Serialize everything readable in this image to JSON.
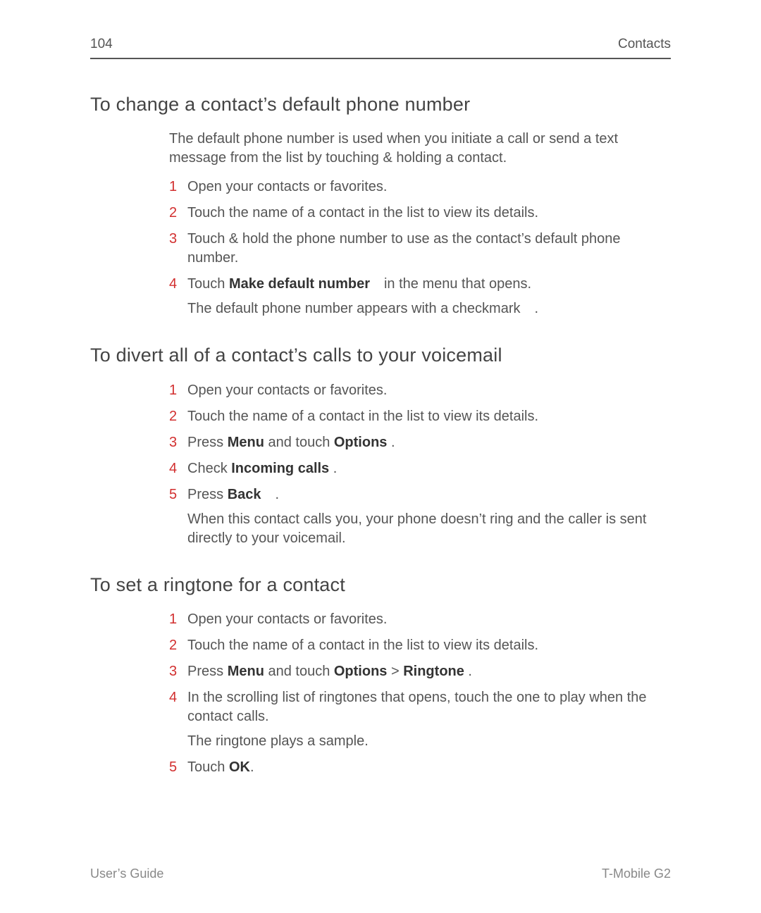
{
  "header": {
    "page_number": "104",
    "section": "Contacts"
  },
  "footer": {
    "left": "User’s Guide",
    "right": "T-Mobile G2"
  },
  "sections": [
    {
      "title": "To change a contact’s default phone number",
      "intro": "The default phone number is used when you initiate a call or send a text message from the list by touching & holding a contact.",
      "steps": [
        {
          "n": "1",
          "runs": [
            {
              "t": "Open your contacts or favorites."
            }
          ]
        },
        {
          "n": "2",
          "runs": [
            {
              "t": "Touch the name of a contact in the list to view its details."
            }
          ]
        },
        {
          "n": "3",
          "runs": [
            {
              "t": "Touch & hold the phone number to use as the contact’s default phone number."
            }
          ]
        },
        {
          "n": "4",
          "runs": [
            {
              "t": "Touch "
            },
            {
              "t": "Make default number",
              "b": true
            },
            {
              "t": " in the menu that opens."
            }
          ],
          "after": "The default phone number appears with a checkmark ."
        }
      ]
    },
    {
      "title": "To divert all of a contact’s calls to your voicemail",
      "steps": [
        {
          "n": "1",
          "runs": [
            {
              "t": "Open your contacts or favorites."
            }
          ]
        },
        {
          "n": "2",
          "runs": [
            {
              "t": "Touch the name of a contact in the list to view its details."
            }
          ]
        },
        {
          "n": "3",
          "runs": [
            {
              "t": "Press "
            },
            {
              "t": "Menu",
              "b": true
            },
            {
              "t": " and touch "
            },
            {
              "t": "Options",
              "b": true
            },
            {
              "t": " ."
            }
          ]
        },
        {
          "n": "4",
          "runs": [
            {
              "t": "Check "
            },
            {
              "t": "Incoming calls",
              "b": true
            },
            {
              "t": "  ."
            }
          ]
        },
        {
          "n": "5",
          "runs": [
            {
              "t": "Press "
            },
            {
              "t": "Back",
              "b": true
            },
            {
              "t": " ."
            }
          ],
          "after": "When this contact calls you, your phone doesn’t ring and the caller is sent directly to your voicemail."
        }
      ]
    },
    {
      "title": "To set a ringtone for a contact",
      "steps": [
        {
          "n": "1",
          "runs": [
            {
              "t": "Open your contacts or favorites."
            }
          ]
        },
        {
          "n": "2",
          "runs": [
            {
              "t": "Touch the name of a contact in the list to view its details."
            }
          ]
        },
        {
          "n": "3",
          "runs": [
            {
              "t": "Press "
            },
            {
              "t": "Menu",
              "b": true
            },
            {
              "t": " and touch "
            },
            {
              "t": "Options",
              "b": true
            },
            {
              "t": "  > "
            },
            {
              "t": "Ringtone",
              "b": true
            },
            {
              "t": " ."
            }
          ]
        },
        {
          "n": "4",
          "runs": [
            {
              "t": "In the scrolling list of ringtones that opens, touch the one to play when the contact calls."
            }
          ],
          "after": "The ringtone plays a sample."
        },
        {
          "n": "5",
          "runs": [
            {
              "t": "Touch "
            },
            {
              "t": "OK",
              "b": true
            },
            {
              "t": "."
            }
          ]
        }
      ]
    }
  ]
}
